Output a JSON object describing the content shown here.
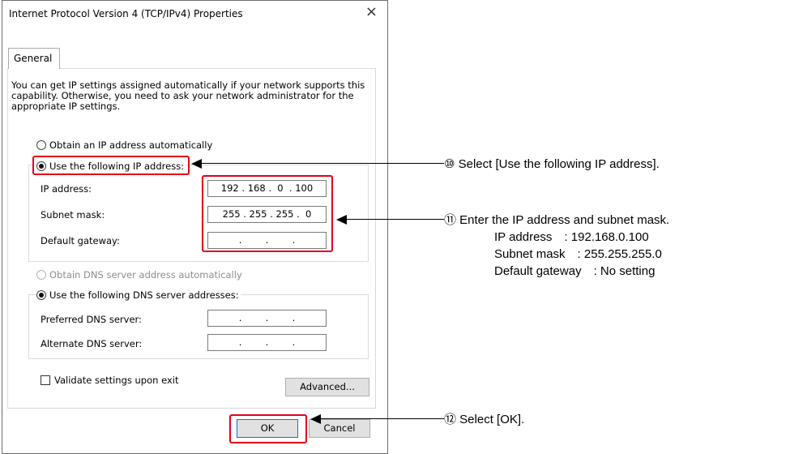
{
  "dialog": {
    "title": "Internet Protocol Version 4 (TCP/IPv4) Properties",
    "close_glyph": "×",
    "tab_general": "General",
    "intro_text": "You can get IP settings assigned automatically if your network supports this capability. Otherwise, you need to ask your network administrator for the appropriate IP settings.",
    "obtain_ip_auto": "Obtain an IP address automatically",
    "use_following_ip": "Use the following IP address:",
    "ip_address_label": "IP address:",
    "ip_address_value": "192 . 168 .  0  . 100",
    "subnet_mask_label": "Subnet mask:",
    "subnet_mask_value": "255 . 255 . 255 .  0",
    "default_gateway_label": "Default gateway:",
    "default_gateway_value": ".        .        .",
    "obtain_dns_auto": "Obtain DNS server address automatically",
    "use_following_dns": "Use the following DNS server addresses:",
    "preferred_dns_label": "Preferred DNS server:",
    "preferred_dns_value": ".        .        .",
    "alternate_dns_label": "Alternate DNS server:",
    "alternate_dns_value": ".        .        .",
    "validate_label": "Validate settings upon exit",
    "advanced_button": "Advanced...",
    "ok_button": "OK",
    "cancel_button": "Cancel",
    "selected_ip_option": "use_following_ip",
    "selected_dns_option": "use_following_dns",
    "validate_checked": false
  },
  "annotations": {
    "step10": "⑩ Select [Use the following IP address].",
    "step11": "⑪ Enter the IP address and subnet mask.",
    "step11_ip": "IP address　: 192.168.0.100",
    "step11_subnet": "Subnet mask　: 255.255.255.0",
    "step11_gateway": "Default gateway　: No setting",
    "step12": "⑫ Select [OK]."
  },
  "colors": {
    "highlight": "#e3001b",
    "ok_border": "#0078d7",
    "button_bg": "#e1e1e1"
  }
}
